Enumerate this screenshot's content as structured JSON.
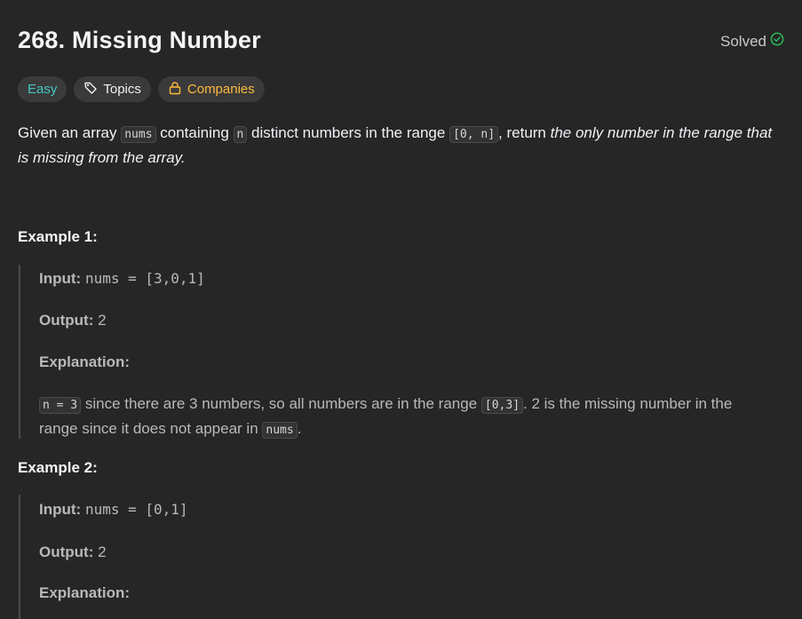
{
  "problem": {
    "title": "268. Missing Number",
    "status_label": "Solved"
  },
  "tags": {
    "difficulty": "Easy",
    "topics": "Topics",
    "companies": "Companies"
  },
  "description": {
    "t1": "Given an array ",
    "c1": "nums",
    "t2": " containing ",
    "c2": "n",
    "t3": " distinct numbers in the range ",
    "c3": "[0, n]",
    "t4": ", return ",
    "em": "the only number in the range that is missing from the array."
  },
  "examples": [
    {
      "title": "Example 1:",
      "input_label": "Input:",
      "input_value": "nums = [3,0,1]",
      "output_label": "Output:",
      "output_value": "2",
      "explanation_label": "Explanation:",
      "expl": {
        "c1": "n = 3",
        "t1": " since there are 3 numbers, so all numbers are in the range ",
        "c2": "[0,3]",
        "t2": ". 2 is the missing number in the range since it does not appear in ",
        "c3": "nums",
        "t3": "."
      }
    },
    {
      "title": "Example 2:",
      "input_label": "Input:",
      "input_value": "nums = [0,1]",
      "output_label": "Output:",
      "output_value": "2",
      "explanation_label": "Explanation:"
    }
  ],
  "colors": {
    "background": "#262626",
    "easy": "#46c6c2",
    "companies": "#ffb93d",
    "solved_check": "#2cbb5d"
  }
}
